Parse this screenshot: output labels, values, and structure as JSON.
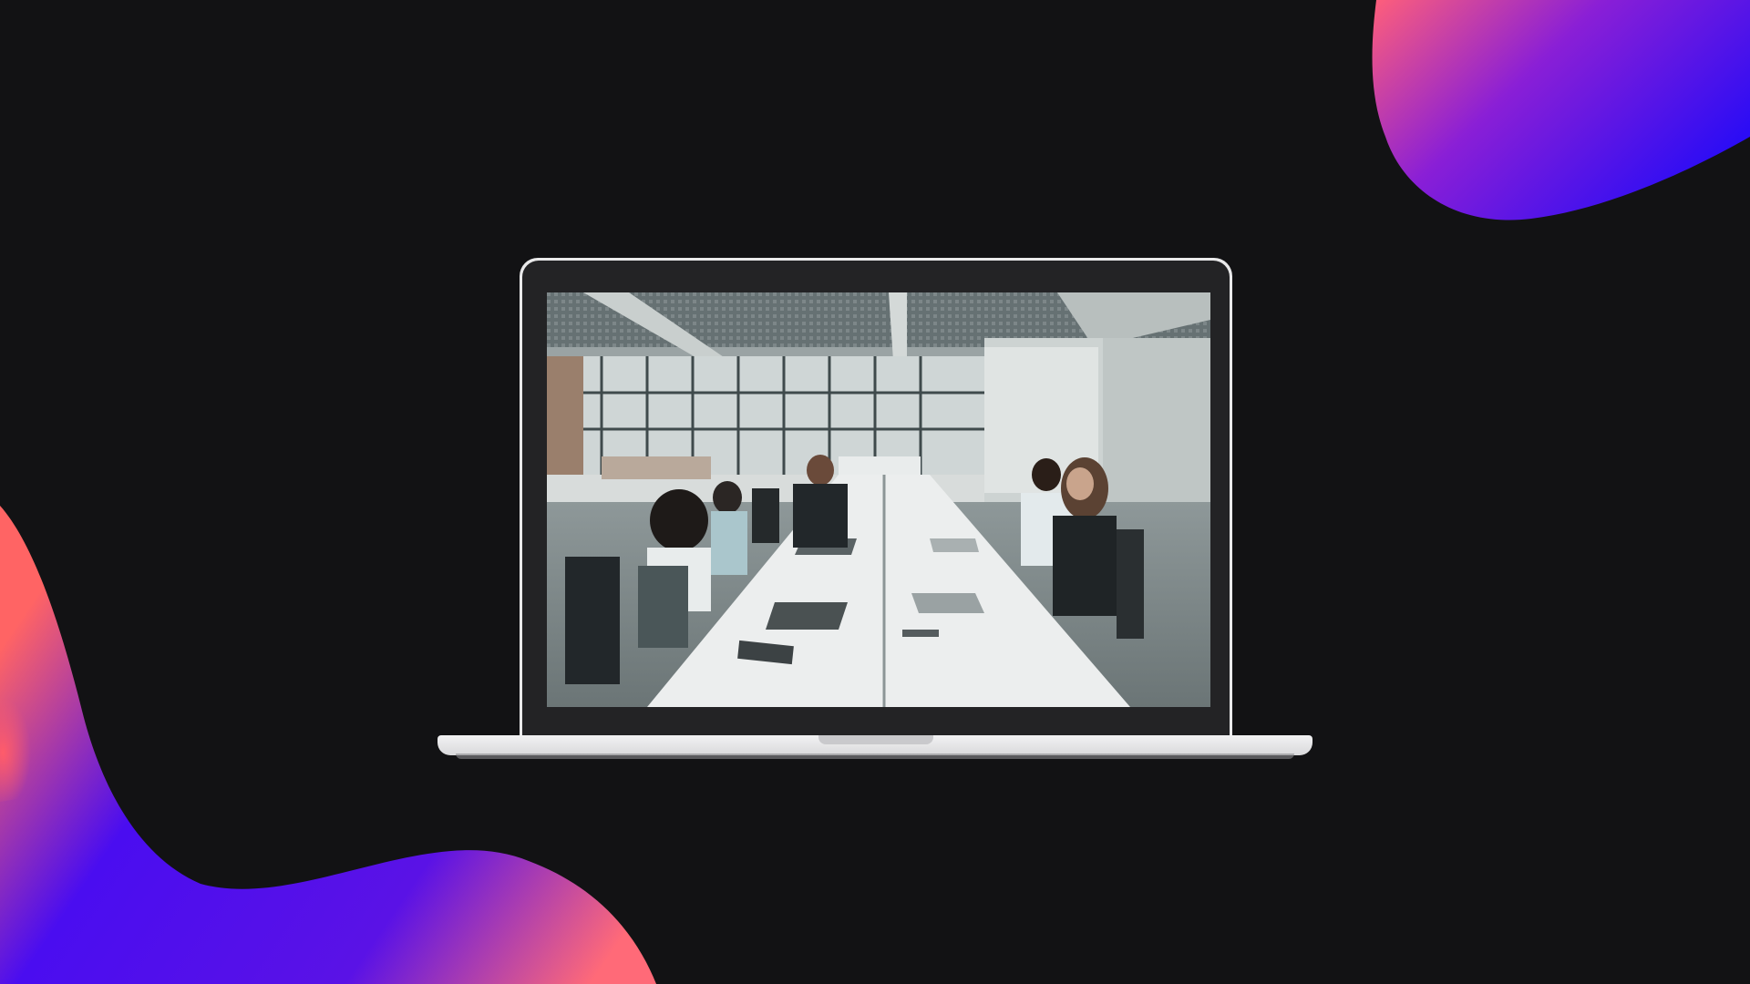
{
  "scene": {
    "background_color": "#121214",
    "accent_gradient": [
      "#ff6f6f",
      "#8a1fd6",
      "#3d0df2"
    ],
    "device": "laptop",
    "screen_content": "office-meeting-photo"
  }
}
